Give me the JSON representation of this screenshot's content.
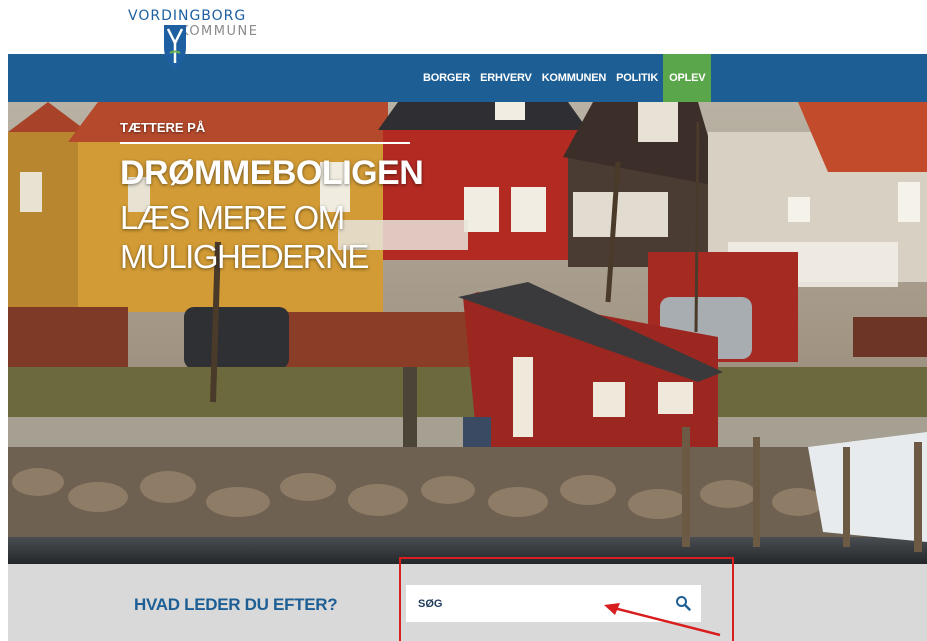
{
  "logo": {
    "line1": "VORDINGBORG",
    "line2": "KOMMUNE"
  },
  "nav": {
    "items": [
      {
        "label": "BORGER"
      },
      {
        "label": "ERHVERV"
      },
      {
        "label": "KOMMUNEN"
      },
      {
        "label": "POLITIK"
      },
      {
        "label": "OPLEV",
        "active": true
      }
    ]
  },
  "hero": {
    "eyebrow": "TÆTTERE PÅ",
    "title": "DRØMMEBOLIGEN",
    "subtitle": "LÆS MERE OM MULIGHEDERNE"
  },
  "search": {
    "question": "HVAD LEDER DU EFTER?",
    "placeholder": "SØG",
    "value": ""
  },
  "colors": {
    "brand_blue": "#1d5f95",
    "active_green": "#5aa64a",
    "search_band": "#d9d9d9",
    "annotation_red": "#d81e1e"
  },
  "icons": {
    "search": "search-icon",
    "logo": "logo-shield-icon"
  }
}
